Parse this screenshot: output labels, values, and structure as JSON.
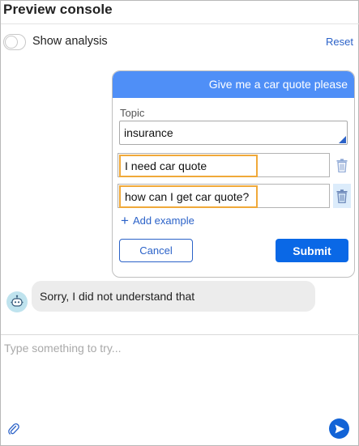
{
  "header": {
    "title": "Preview console"
  },
  "controls": {
    "show_analysis_label": "Show analysis",
    "show_analysis_on": false,
    "reset_label": "Reset"
  },
  "user_message": "Give me a car quote please",
  "training_form": {
    "topic_label": "Topic",
    "topic_value": "insurance",
    "examples": [
      {
        "text": "I need car quote"
      },
      {
        "text": "how can I get car quote?"
      }
    ],
    "add_example_label": "Add example",
    "cancel_label": "Cancel",
    "submit_label": "Submit"
  },
  "bot_message": "Sorry, I did not understand that",
  "composer": {
    "placeholder": "Type something to try..."
  },
  "colors": {
    "accent": "#0a68e6",
    "user_bubble": "#4f8ff7",
    "highlight_border": "#f0a93a",
    "bot_bubble": "#ececec"
  },
  "icons": [
    "trash-icon",
    "plus-icon",
    "bot-avatar-icon",
    "paperclip-icon",
    "send-icon"
  ]
}
